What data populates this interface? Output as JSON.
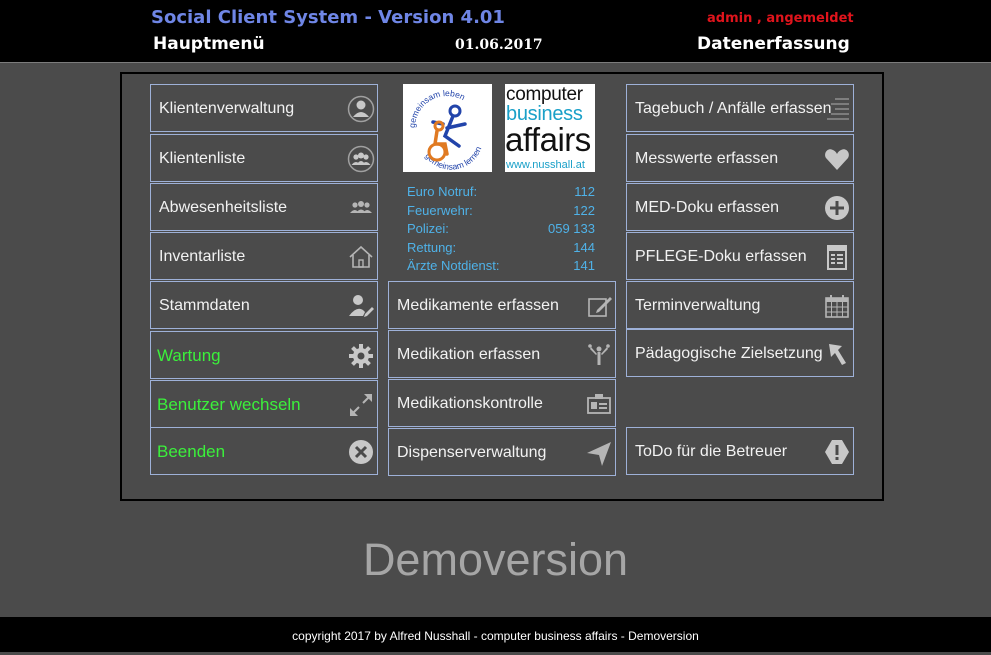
{
  "header": {
    "app_title": "Social Client System - Version 4.01",
    "user_status": "admin , angemeldet",
    "menu_title": "Hauptmenü",
    "date": "01.06.2017",
    "section_title": "Datenerfassung"
  },
  "left_menu": [
    {
      "label": "Klientenverwaltung",
      "icon": "person-icon"
    },
    {
      "label": "Klientenliste",
      "icon": "group-icon"
    },
    {
      "label": "Abwesenheitsliste",
      "icon": "people-icon"
    },
    {
      "label": "Inventarliste",
      "icon": "house-icon"
    },
    {
      "label": "Stammdaten",
      "icon": "user-edit-icon"
    },
    {
      "label": "Wartung",
      "icon": "gear-icon"
    },
    {
      "label": "Benutzer wechseln",
      "icon": "expand-arrows-icon"
    },
    {
      "label": "Beenden",
      "icon": "close-icon"
    }
  ],
  "logos": {
    "circle_text_top": "gemeinsam leben",
    "circle_text_bottom": "gemeinsam lernen",
    "cba_line1": "computer",
    "cba_line2": "business",
    "cba_line3": "affairs",
    "cba_url": "www.nusshall.at"
  },
  "emergency": [
    {
      "label": "Euro Notruf:",
      "number": "112"
    },
    {
      "label": "Feuerwehr:",
      "number": "122"
    },
    {
      "label": "Polizei:",
      "number": "059 133"
    },
    {
      "label": "Rettung:",
      "number": "144"
    },
    {
      "label": "Ärzte Notdienst:",
      "number": "141"
    }
  ],
  "center_menu": [
    {
      "label": "Medikamente erfassen",
      "icon": "edit-icon"
    },
    {
      "label": "Medikation erfassen",
      "icon": "figures-icon"
    },
    {
      "label": "Medikationskontrolle",
      "icon": "id-card-icon"
    },
    {
      "label": "Dispenserverwaltung",
      "icon": "send-arrow-icon"
    }
  ],
  "right_menu": [
    {
      "label": "Tagebuch / Anfälle erfassen",
      "icon": "lines-icon"
    },
    {
      "label": "Messwerte erfassen",
      "icon": "heart-icon"
    },
    {
      "label": "MED-Doku erfassen",
      "icon": "plus-icon"
    },
    {
      "label": "PFLEGE-Doku erfassen",
      "icon": "document-icon"
    },
    {
      "label": "Terminverwaltung",
      "icon": "calendar-icon"
    },
    {
      "label": "Pädagogische Zielsetzung",
      "icon": "pointer-arrow-icon"
    },
    {
      "label": "ToDo für die Betreuer",
      "icon": "warning-icon"
    }
  ],
  "watermark": "Demoversion",
  "footer": "copyright 2017 by Alfred Nusshall - computer business affairs - Demoversion",
  "colors": {
    "background": "#4b4b4b",
    "title_blue": "#6f86e6",
    "status_red": "#e0141c",
    "green_text": "#3bf03b",
    "border_blue": "#9eb1d8",
    "emergency_blue": "#4fb2e8"
  }
}
